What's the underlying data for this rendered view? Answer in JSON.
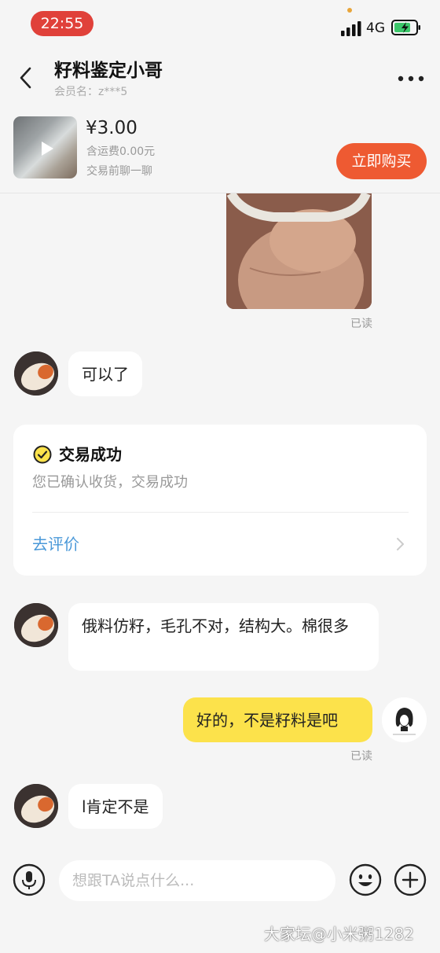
{
  "status_bar": {
    "time": "22:55",
    "network": "4G"
  },
  "header": {
    "title": "籽料鉴定小哥",
    "member_label": "会员名：z***5"
  },
  "product": {
    "price": "¥3.00",
    "shipping": "含运费0.00元",
    "note": "交易前聊一聊",
    "buy_label": "立即购买"
  },
  "messages": {
    "read_label": "已读",
    "m1": "可以了",
    "m2": "俄料仿籽，毛孔不对，结构大。棉很多",
    "m3": "好的，不是籽料是吧",
    "m4": "l肯定不是"
  },
  "trade_card": {
    "title": "交易成功",
    "subtitle": "您已确认收货，交易成功",
    "link": "去评价"
  },
  "input_bar": {
    "placeholder": "想跟TA说点什么..."
  },
  "watermark": "大家坛@小米粥1282",
  "colors": {
    "buy_button": "#ee5a32",
    "my_bubble": "#fce24b",
    "link": "#4a98d8",
    "time_pill": "#e0413a"
  }
}
